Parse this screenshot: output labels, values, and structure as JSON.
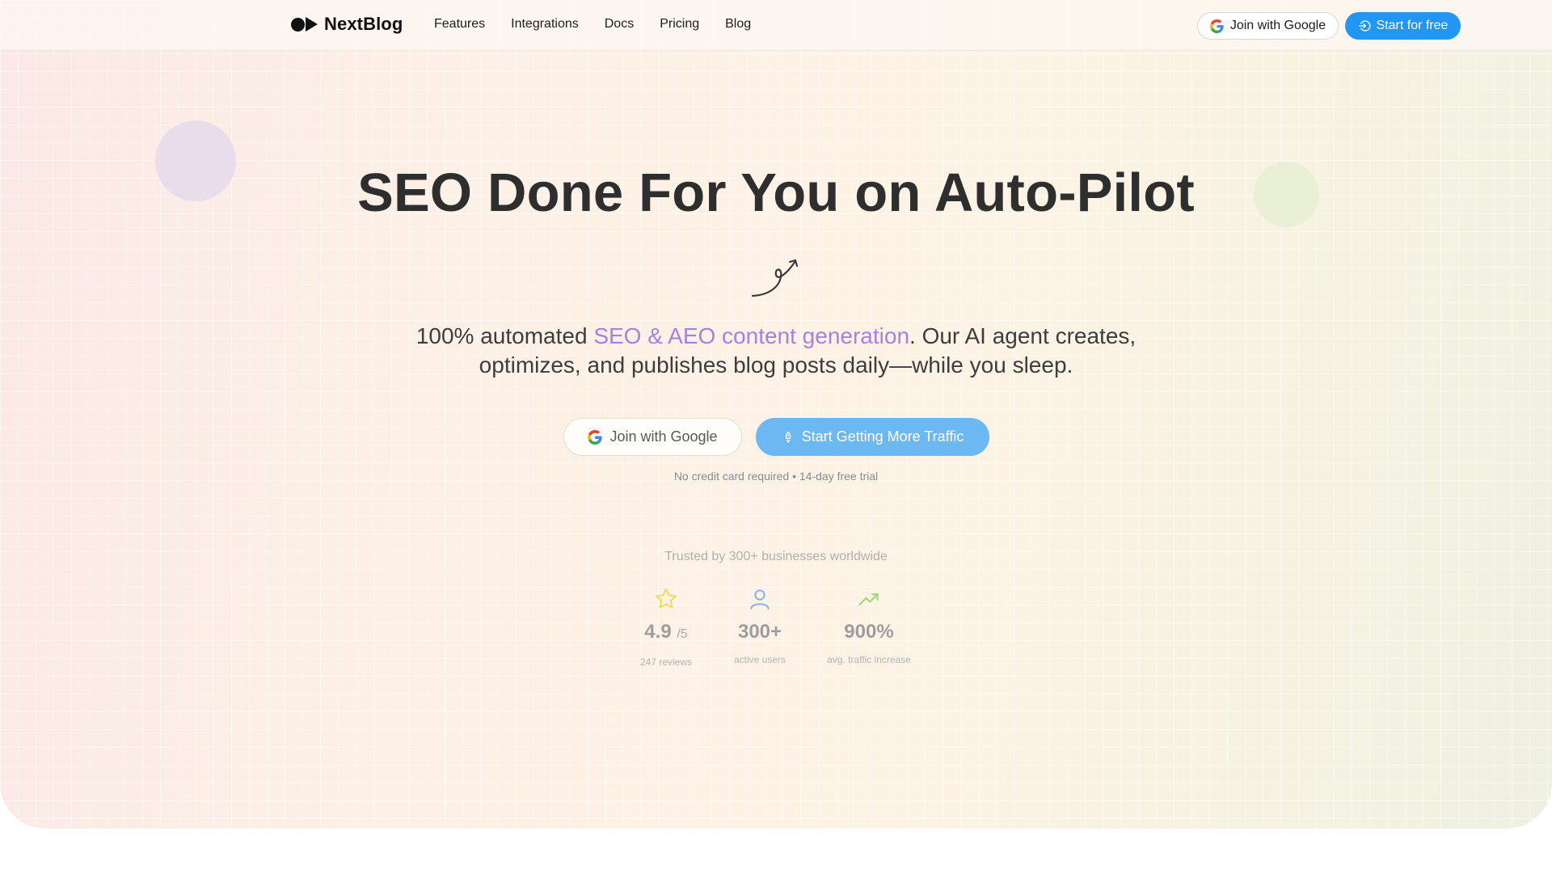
{
  "navbar": {
    "brand": "NextBlog",
    "links": [
      "Features",
      "Integrations",
      "Docs",
      "Pricing",
      "Blog"
    ],
    "google_button": "Join with Google",
    "start_button": "Start for free"
  },
  "hero": {
    "headline": "SEO Done For You on Auto-Pilot",
    "subtitle_prefix": "100% automated ",
    "subtitle_highlight": "SEO & AEO content generation",
    "subtitle_suffix_line1": ". Our AI agent creates,",
    "subtitle_line2": "optimizes, and publishes blog posts daily—while you sleep.",
    "google_button": "Join with Google",
    "primary_button": "Start Getting More Traffic",
    "note": "No credit card required • 14-day free trial",
    "trusted": "Trusted by 300+ businesses worldwide"
  },
  "stats": [
    {
      "icon": "star-icon",
      "value": "4.9",
      "suffix": "/5",
      "label": "247 reviews"
    },
    {
      "icon": "user-icon",
      "value": "300+",
      "label": "active users"
    },
    {
      "icon": "trending-up-icon",
      "value": "900%",
      "label": "avg. traffic increase"
    }
  ],
  "colors": {
    "primary_blue": "#2196f3",
    "primary_blue_light": "#6cb8f3",
    "highlight_purple": "#a97ee6",
    "star_yellow": "#f3dc62",
    "user_blue": "#8fb3e6",
    "trend_green": "#9fd67c"
  }
}
